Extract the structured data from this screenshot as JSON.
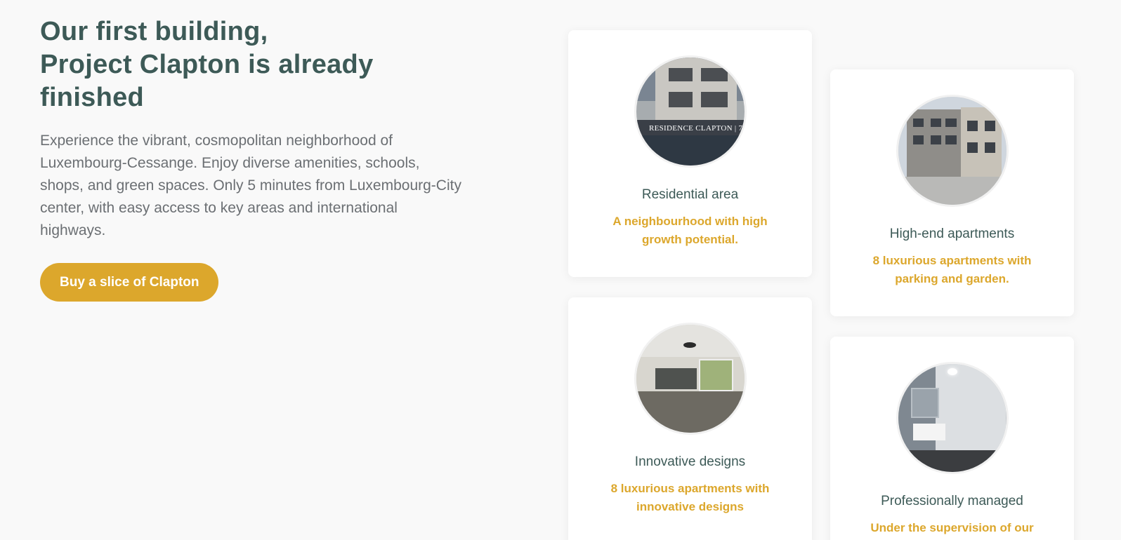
{
  "hero": {
    "headline_lines": [
      "Our first building,",
      "Project Clapton is already",
      "finished"
    ],
    "intro": "Experience the vibrant, cosmopolitan neighborhood of Luxembourg-Cessange. Enjoy diverse amenities, schools, shops, and green spaces. Only 5 minutes from Luxembourg-City center, with easy access to key areas and international highways.",
    "cta_label": "Buy a slice of Clapton"
  },
  "features": [
    {
      "title": "Residential area",
      "text": "A neighbourhood with high growth potential.",
      "photo_sign_text": "RESIDENCE CLAPTON | 7"
    },
    {
      "title": "High-end apartments",
      "text": "8 luxurious apartments with parking and garden."
    },
    {
      "title": "Innovative designs",
      "text": "8 luxurious apartments with innovative designs"
    },
    {
      "title": "Professionally managed",
      "text": "Under the supervision of our"
    }
  ],
  "colors": {
    "page_background": "#f9f9f9",
    "heading": "#3d5a57",
    "body_text": "#6b6f73",
    "accent": "#dca72c",
    "card": "#ffffff"
  }
}
